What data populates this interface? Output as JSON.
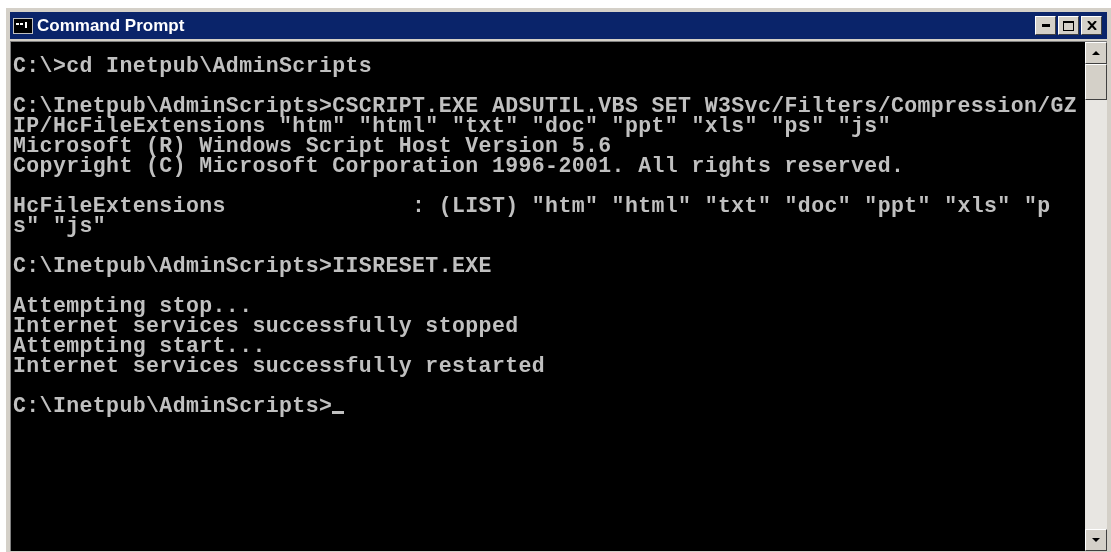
{
  "window": {
    "title": "Command Prompt"
  },
  "console": {
    "blocks": [
      [
        "C:\\>cd Inetpub\\AdminScripts"
      ],
      [
        "C:\\Inetpub\\AdminScripts>CSCRIPT.EXE ADSUTIL.VBS SET W3Svc/Filters/Compression/GZ",
        "IP/HcFileExtensions \"htm\" \"html\" \"txt\" \"doc\" \"ppt\" \"xls\" \"ps\" \"js\"",
        "Microsoft (R) Windows Script Host Version 5.6",
        "Copyright (C) Microsoft Corporation 1996-2001. All rights reserved."
      ],
      [
        "HcFileExtensions              : (LIST) \"htm\" \"html\" \"txt\" \"doc\" \"ppt\" \"xls\" \"p",
        "s\" \"js\""
      ],
      [
        "C:\\Inetpub\\AdminScripts>IISRESET.EXE"
      ],
      [
        "Attempting stop...",
        "Internet services successfully stopped",
        "Attempting start...",
        "Internet services successfully restarted"
      ],
      [
        "C:\\Inetpub\\AdminScripts>"
      ]
    ]
  }
}
